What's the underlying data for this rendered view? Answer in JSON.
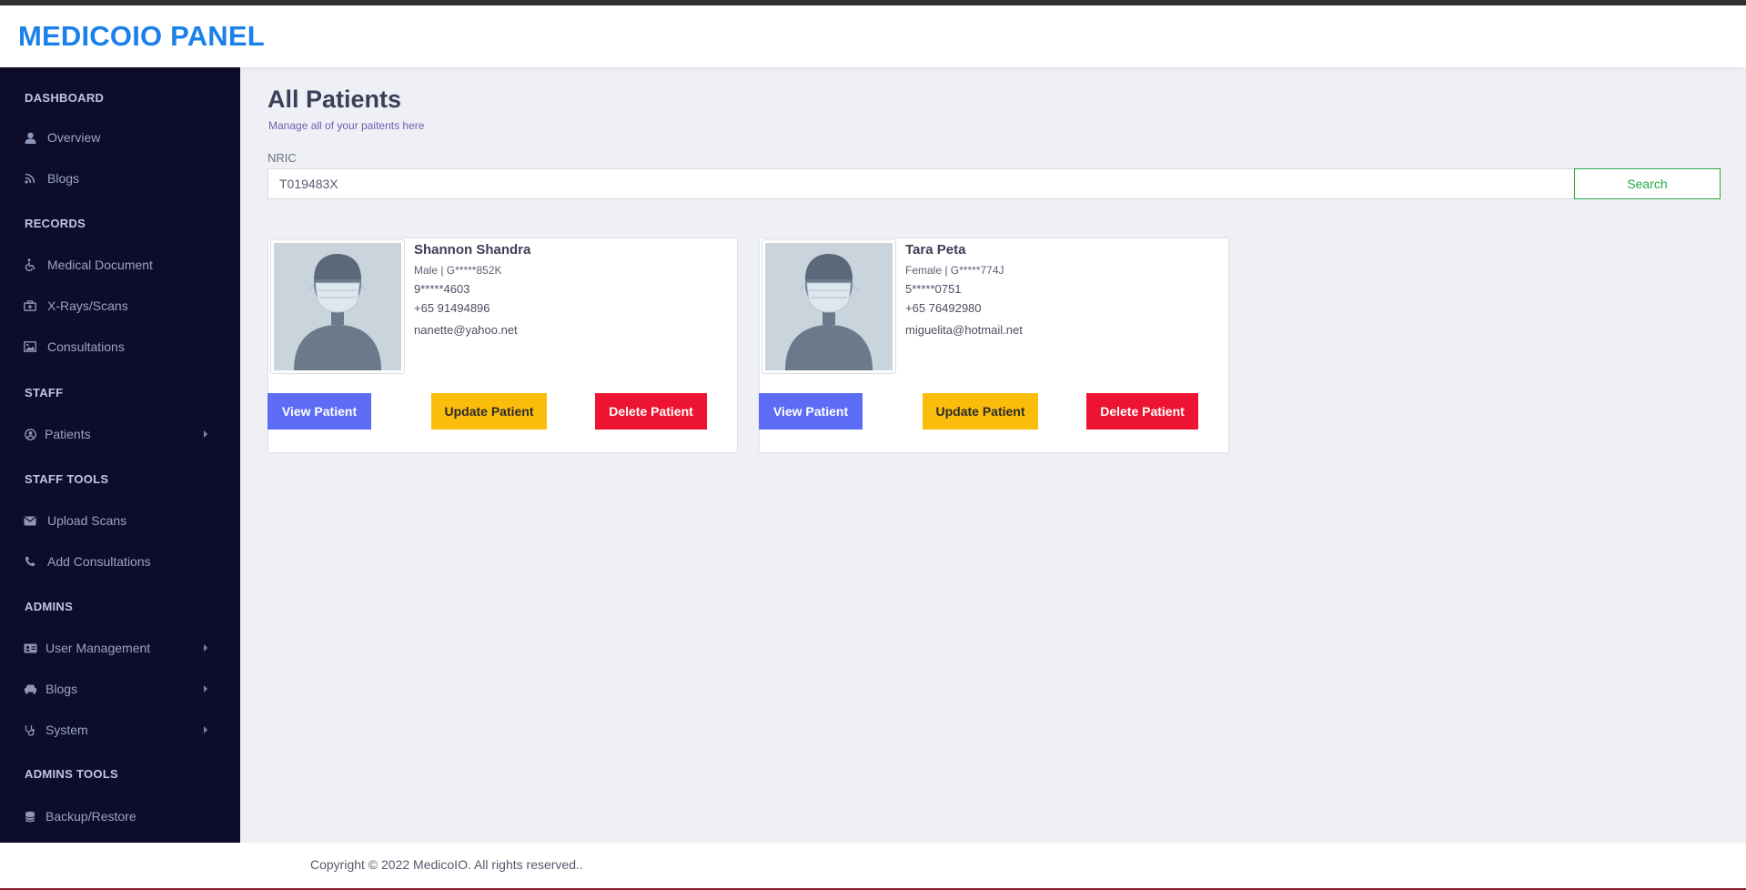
{
  "app": {
    "brand": "MEDICOIO PANEL"
  },
  "sidebar": {
    "sections": [
      {
        "title": "DASHBOARD",
        "items": [
          {
            "label": "Overview",
            "icon": "user-icon"
          },
          {
            "label": "Blogs",
            "icon": "rss-icon"
          }
        ]
      },
      {
        "title": "RECORDS",
        "items": [
          {
            "label": "Medical Document",
            "icon": "wheelchair-icon"
          },
          {
            "label": "X-Rays/Scans",
            "icon": "medkit-icon"
          },
          {
            "label": "Consultations",
            "icon": "image-icon"
          }
        ]
      },
      {
        "title": "STAFF",
        "items": [
          {
            "label": "Patients",
            "icon": "user-circle-icon",
            "submenu": true
          }
        ]
      },
      {
        "title": "STAFF TOOLS",
        "items": [
          {
            "label": "Upload Scans",
            "icon": "envelope-icon"
          },
          {
            "label": "Add Consultations",
            "icon": "phone-icon"
          }
        ]
      },
      {
        "title": "ADMINS",
        "items": [
          {
            "label": "User Management",
            "icon": "id-card-icon",
            "submenu": true
          },
          {
            "label": "Blogs",
            "icon": "car-icon",
            "submenu": true
          },
          {
            "label": "System",
            "icon": "stethoscope-icon",
            "submenu": true
          }
        ]
      },
      {
        "title": "ADMINS TOOLS",
        "items": [
          {
            "label": "Backup/Restore",
            "icon": "database-icon"
          }
        ]
      }
    ]
  },
  "main": {
    "title": "All Patients",
    "subtitle": "Manage all of your paitents here",
    "search": {
      "label": "NRIC",
      "value": "T019483X",
      "button": "Search"
    },
    "patients": [
      {
        "name": "Shannon Shandra",
        "gender_nric": "Male | G*****852K",
        "masked_id": "9*****4603",
        "phone": "+65 91494896",
        "email": "nanette@yahoo.net",
        "buttons": {
          "view": "View Patient",
          "update": "Update Patient",
          "delete": "Delete Patient"
        }
      },
      {
        "name": "Tara Peta",
        "gender_nric": "Female | G*****774J",
        "masked_id": "5*****0751",
        "phone": "+65 76492980",
        "email": "miguelita@hotmail.net",
        "buttons": {
          "view": "View Patient",
          "update": "Update Patient",
          "delete": "Delete Patient"
        }
      }
    ]
  },
  "footer": {
    "text": "Copyright © 2022 MedicoIO. All rights reserved.."
  },
  "colors": {
    "brand": "#1a80ea",
    "sidebar_bg": "#0d0c2b",
    "view_button": "#5c6cf5",
    "update_button": "#fbbd0b",
    "delete_button": "#ec1431",
    "search_button": "#28a745"
  }
}
